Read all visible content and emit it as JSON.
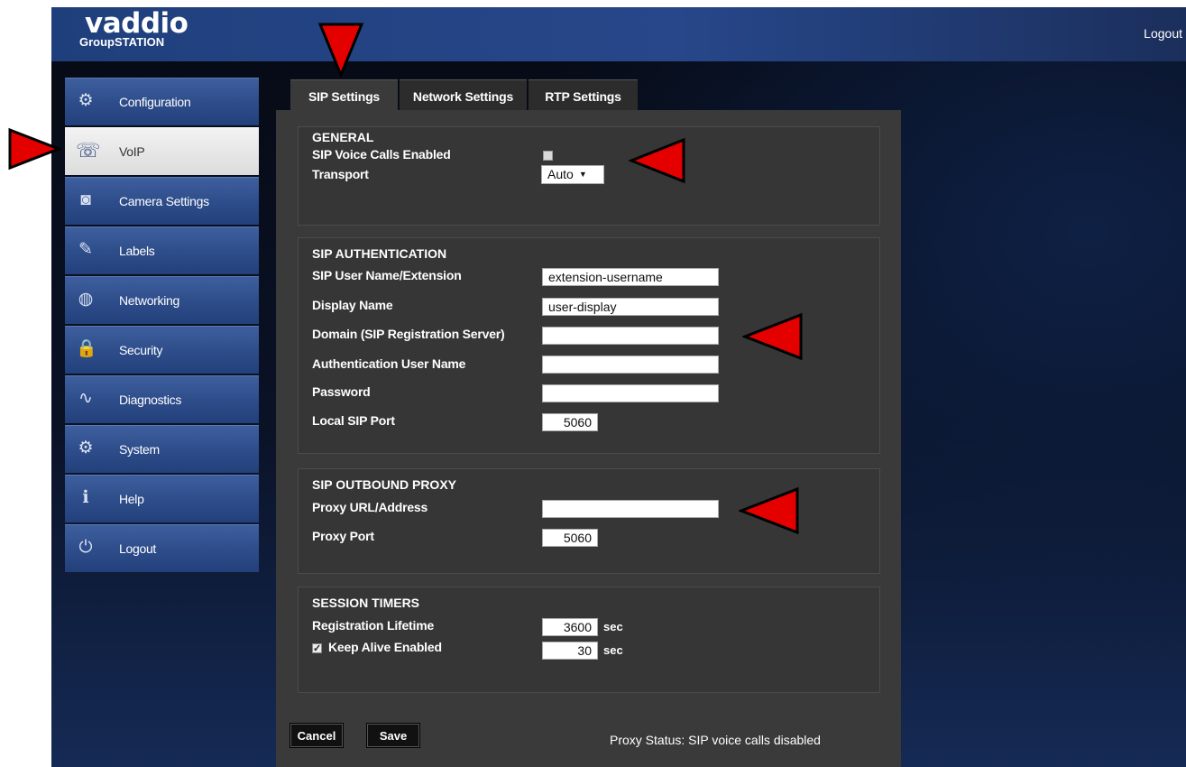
{
  "brand": {
    "logo": "vaddio",
    "product": "GroupSTATION"
  },
  "top_logout": "Logout",
  "sidebar": {
    "items": [
      {
        "label": "Configuration",
        "icon": "gear-icon",
        "glyph": "⚙",
        "active": false
      },
      {
        "label": "VoIP",
        "icon": "phone-icon",
        "glyph": "☏",
        "active": true
      },
      {
        "label": "Camera Settings",
        "icon": "camera-icon",
        "glyph": "◙",
        "active": false
      },
      {
        "label": "Labels",
        "icon": "pen-icon",
        "glyph": "✎",
        "active": false
      },
      {
        "label": "Networking",
        "icon": "globe-icon",
        "glyph": "◍",
        "active": false
      },
      {
        "label": "Security",
        "icon": "lock-icon",
        "glyph": "🔒",
        "active": false
      },
      {
        "label": "Diagnostics",
        "icon": "diagnostics-icon",
        "glyph": "∿",
        "active": false
      },
      {
        "label": "System",
        "icon": "system-gear-icon",
        "glyph": "⚙",
        "active": false
      },
      {
        "label": "Help",
        "icon": "info-icon",
        "glyph": "ℹ",
        "active": false
      },
      {
        "label": "Logout",
        "icon": "power-icon",
        "glyph": "⏻",
        "active": false
      }
    ]
  },
  "tabs": [
    {
      "label": "SIP Settings",
      "active": true
    },
    {
      "label": "Network Settings",
      "active": false
    },
    {
      "label": "RTP Settings",
      "active": false
    }
  ],
  "general": {
    "title": "GENERAL",
    "sip_voice_label": "SIP Voice Calls Enabled",
    "sip_voice_checked": false,
    "transport_label": "Transport",
    "transport_value": "Auto",
    "transport_caret": "▼"
  },
  "auth": {
    "title": "SIP AUTHENTICATION",
    "user_name_label": "SIP User Name/Extension",
    "user_name_value": "extension-username",
    "display_name_label": "Display Name",
    "display_name_value": "user-display",
    "domain_label": "Domain (SIP Registration Server)",
    "domain_value": "",
    "auth_user_label": "Authentication User Name",
    "auth_user_value": "",
    "password_label": "Password",
    "password_value": "",
    "local_port_label": "Local SIP Port",
    "local_port_value": "5060"
  },
  "proxy": {
    "title": "SIP OUTBOUND PROXY",
    "url_label": "Proxy URL/Address",
    "url_value": "",
    "port_label": "Proxy Port",
    "port_value": "5060"
  },
  "timers": {
    "title": "SESSION TIMERS",
    "lifetime_label": "Registration Lifetime",
    "lifetime_value": "3600",
    "lifetime_unit": "sec",
    "keepalive_label": "Keep Alive Enabled",
    "keepalive_checked": true,
    "keepalive_check_glyph": "✓",
    "keepalive_value": "30",
    "keepalive_unit": "sec"
  },
  "buttons": {
    "cancel": "Cancel",
    "save": "Save"
  },
  "proxy_status": "Proxy Status: SIP voice calls disabled",
  "colors": {
    "marker": "#e50000",
    "marker_outline": "#000000",
    "nav_blue": "#2e4d8b",
    "panel": "#3a3a3a"
  }
}
